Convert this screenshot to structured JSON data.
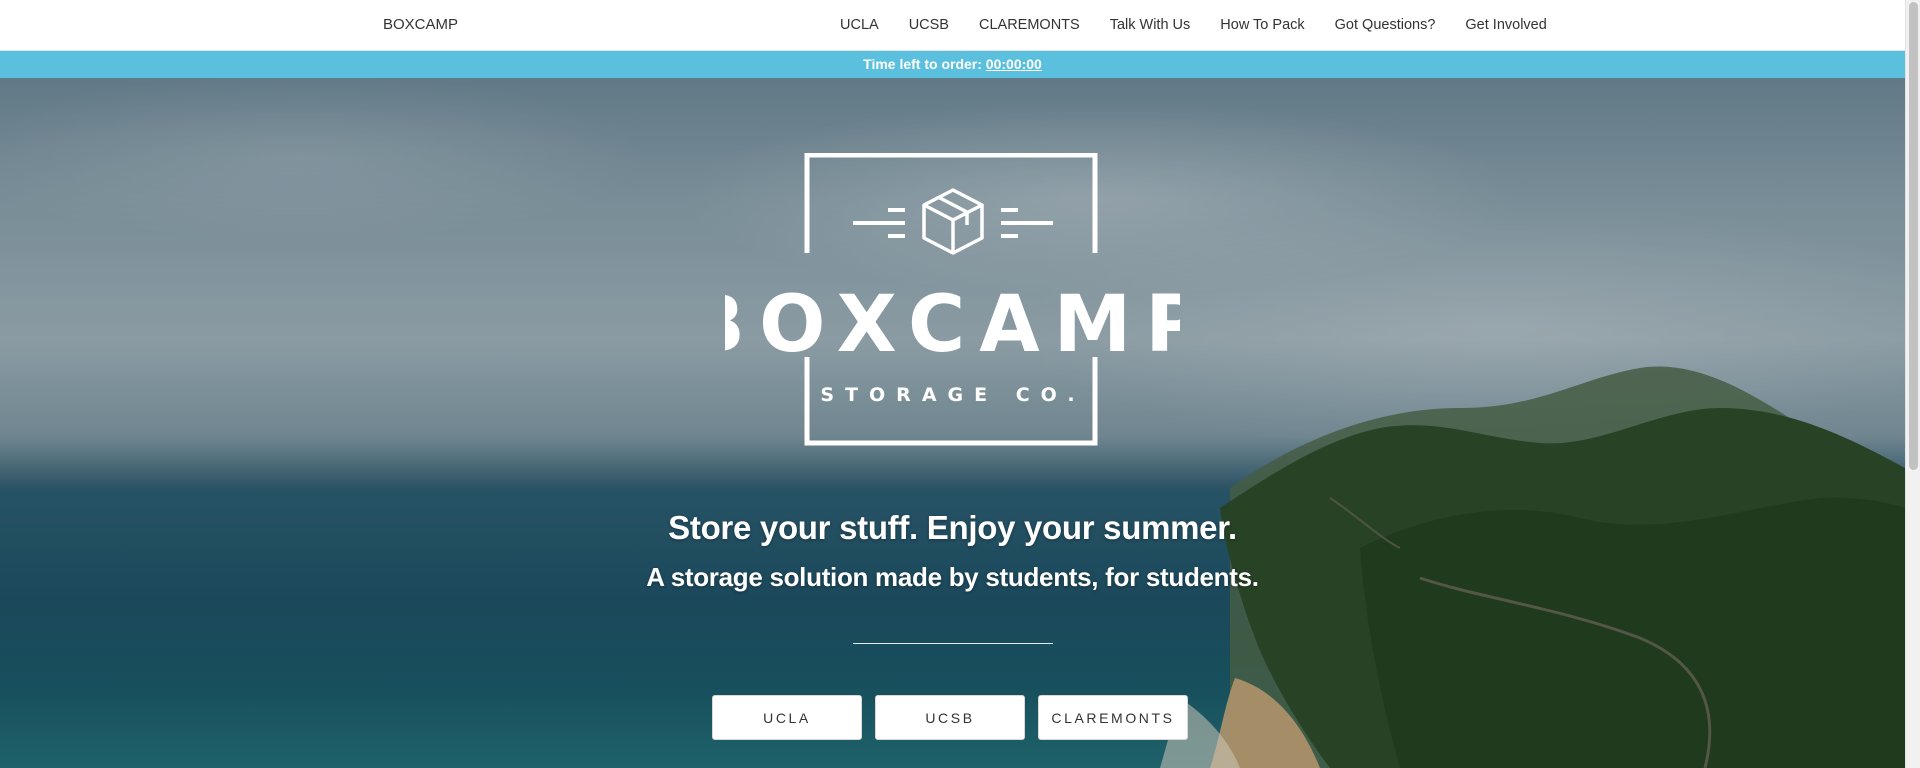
{
  "navbar": {
    "brand": "BOXCAMP",
    "links": [
      "UCLA",
      "UCSB",
      "CLAREMONTS",
      "Talk With Us",
      "How To Pack",
      "Got Questions?",
      "Get Involved"
    ]
  },
  "banner": {
    "label": "Time left to order:",
    "countdown": "00:00:00",
    "color": "#5bc0de"
  },
  "hero": {
    "logo_title": "BOXCAMP",
    "logo_subtitle": "STORAGE CO.",
    "logo_icon": "box-icon",
    "headline": "Store your stuff. Enjoy your summer.",
    "subheadline": "A storage solution made by students, for students.",
    "buttons": [
      "UCLA",
      "UCSB",
      "CLAREMONTS"
    ]
  }
}
